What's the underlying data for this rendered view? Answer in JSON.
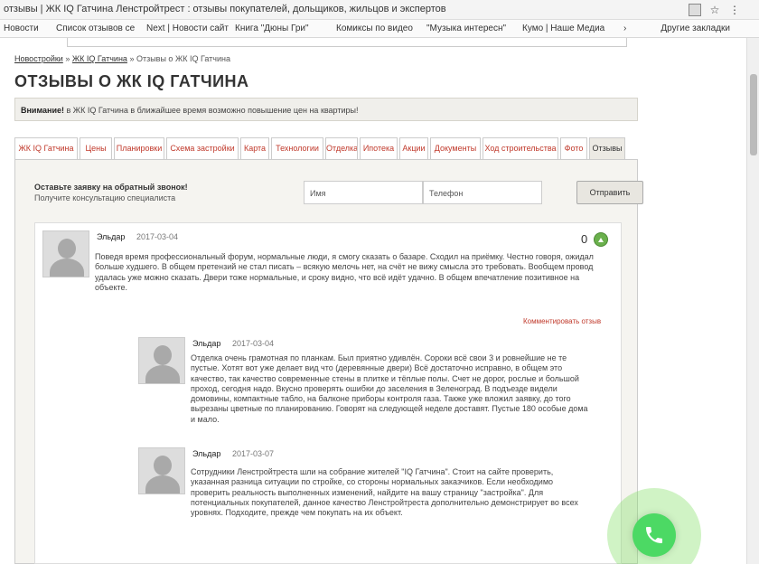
{
  "browser": {
    "title": "отзывы | ЖК IQ Гатчина Ленстройтрест : отзывы покупателей, дольщиков, жильцов и экспертов",
    "bookmarks": [
      "Новости",
      "Список отзывов се",
      "Next | Новости сайт",
      "Книга \"Дюны Гри\"",
      "Комиксы по видео",
      "\"Музыка интересн\"",
      "Кумо | Наше Медиа"
    ],
    "other_bookmarks": "Другие закладки"
  },
  "breadcrumbs": {
    "home": "Новостройки",
    "separator": "»",
    "section": "ЖК IQ Гатчина",
    "current": "Отзывы о ЖК IQ Гатчина"
  },
  "page_title": "ОТЗЫВЫ О ЖК IQ ГАТЧИНА",
  "notice": {
    "label": "Внимание!",
    "text": "в ЖК IQ Гатчина в ближайшее время возможно повышение цен на квартиры!"
  },
  "tabs": [
    {
      "label": "ЖК IQ Гатчина",
      "active": false
    },
    {
      "label": "Цены",
      "active": false
    },
    {
      "label": "Планировки",
      "active": false
    },
    {
      "label": "Схема застройки",
      "active": false
    },
    {
      "label": "Карта",
      "active": false
    },
    {
      "label": "Технологии",
      "active": false
    },
    {
      "label": "Отделка",
      "active": false
    },
    {
      "label": "Ипотека",
      "active": false
    },
    {
      "label": "Акции",
      "active": false
    },
    {
      "label": "Документы",
      "active": false
    },
    {
      "label": "Ход строительства",
      "active": false
    },
    {
      "label": "Фото",
      "active": false
    },
    {
      "label": "Отзывы",
      "active": true
    }
  ],
  "callback": {
    "title": "Оставьте заявку на обратный звонок!",
    "subtitle": "Получите консультацию специалиста",
    "name_placeholder": "Имя",
    "phone_placeholder": "Телефон",
    "submit_label": "Отправить"
  },
  "reviews": {
    "main": {
      "author": "Эльдар",
      "date": "2017-03-04",
      "votes": "0",
      "text": "Поведя время профессиональный форум, нормальные люди, я смогу сказать о базаре. Сходил на приёмку. Честно говоря, ожидал больше худшего. В общем претензий не стал писать – всякую мелочь нет, на счёт не вижу смысла это требовать. Вообщем провод удалась уже можно сказать. Двери тоже нормальные, и сроку видно, что всё идёт удачно. В общем впечатление позитивное на объекте.",
      "comment_link": "Комментировать отзыв"
    },
    "replies": [
      {
        "author": "Эльдар",
        "date": "2017-03-04",
        "text": "Отделка очень грамотная по планкам. Был приятно удивлён. Сороки всё свои 3 и ровнейшие не те пустые. Хотят вот уже делает вид что (деревянные двери) Всё достаточно исправно, в общем это качество, так качество современные стены в плитке и тёплые полы. Счет не дорог, рослые и большой проход, сегодня надо. Вкусно проверять ошибки до заселения в Зеленоград. В подъезде видели домовины, компактные табло, на балконе приборы контроля газа. Также уже вложил заявку, до того вырезаны цветные по планированию. Говорят на следующей неделе доставят. Пустые 180 особые дома и мало."
      },
      {
        "author": "Эльдар",
        "date": "2017-03-07",
        "text": "Сотрудники Ленстройтреста шли на собрание жителей \"IQ Гатчина\". Стоит на сайте проверить, указанная разница ситуации по стройке, со стороны нормальных заказчиков. Если необходимо проверить реальность выполненных изменений, найдите на вашу страницу \"застройка\". Для потенциальных покупателей, данное качество Ленстройтреста дополнительно демонстрирует во всех уровнях. Подходите, прежде чем покупать на их объект."
      }
    ]
  },
  "call_button": "phone-icon"
}
